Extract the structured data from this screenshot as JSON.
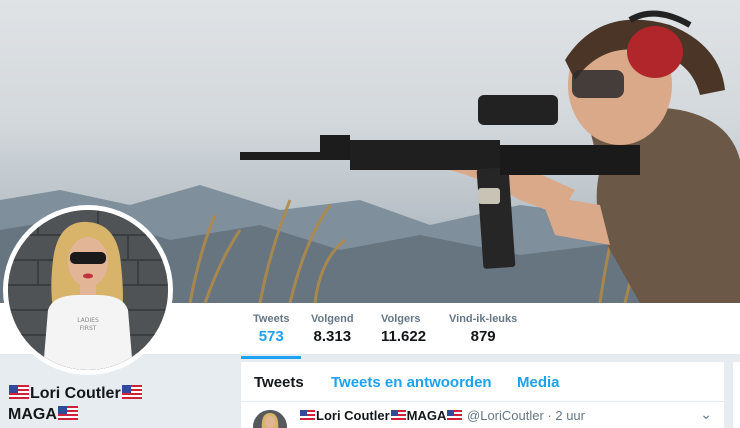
{
  "profile": {
    "name_line1": "Lori Coutler",
    "name_line2": "MAGA"
  },
  "stats": [
    {
      "label": "Tweets",
      "value": "573"
    },
    {
      "label": "Volgend",
      "value": "8.313"
    },
    {
      "label": "Volgers",
      "value": "11.622"
    },
    {
      "label": "Vind-ik-leuks",
      "value": "879"
    }
  ],
  "tabs": [
    {
      "label": "Tweets"
    },
    {
      "label": "Tweets en antwoorden"
    },
    {
      "label": "Media"
    }
  ],
  "tweet": {
    "name": "Lori Coutler",
    "name_suffix": "MAGA",
    "handle": "@LoriCoutler",
    "time": "· 2 uur"
  },
  "icons": {
    "flag": "us-flag-icon",
    "caret": "chevron-down-icon"
  },
  "colors": {
    "accent": "#1da1f2",
    "text": "#14171a",
    "muted": "#657786",
    "background": "#e6ecf0"
  }
}
